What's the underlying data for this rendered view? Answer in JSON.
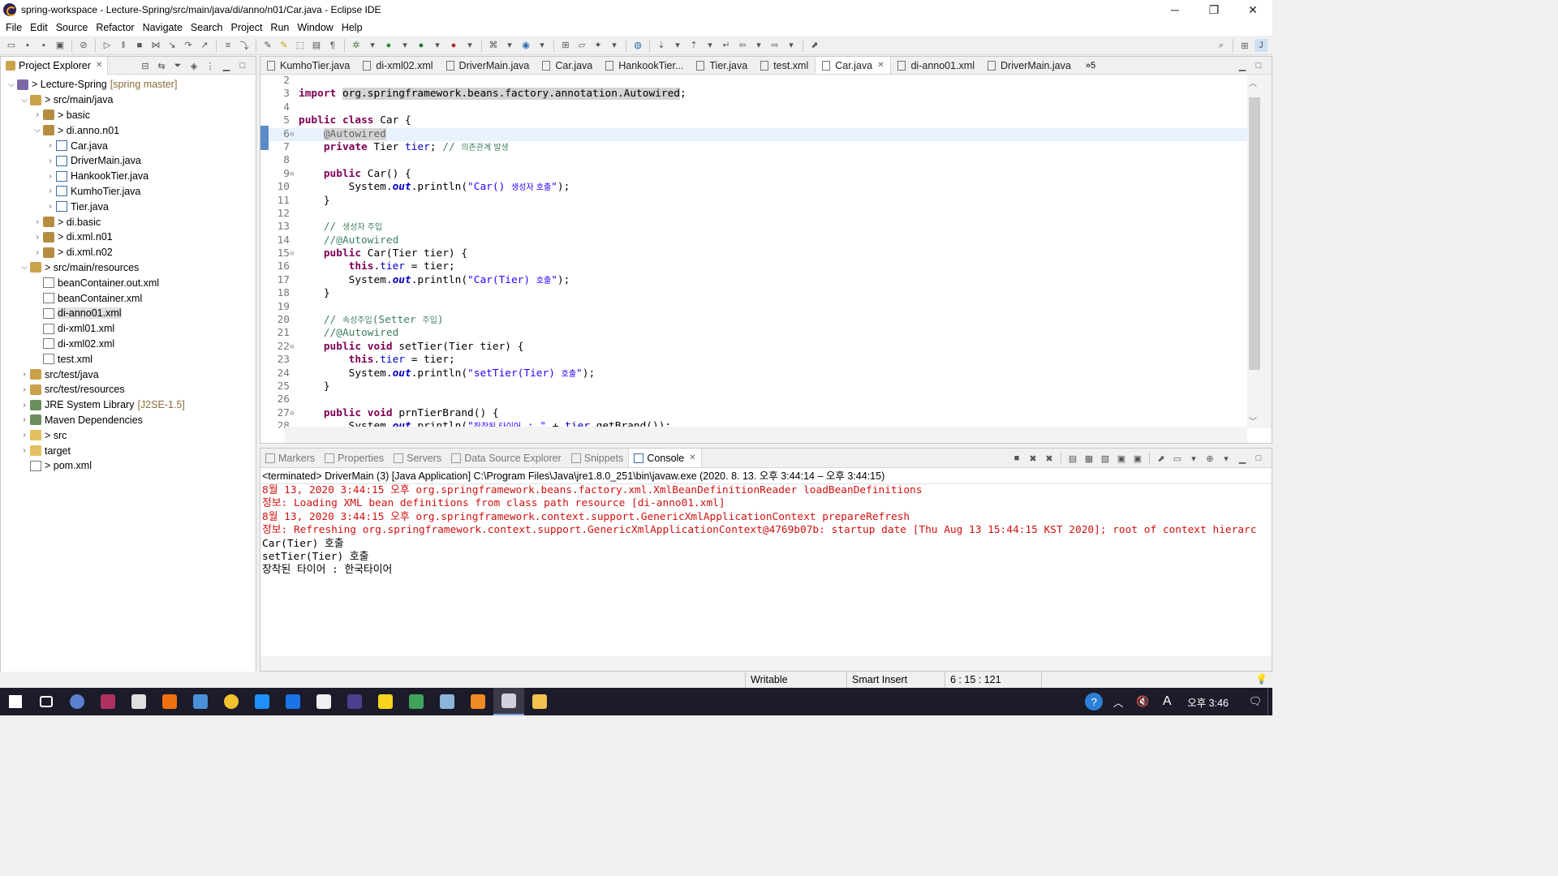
{
  "window": {
    "title": "spring-workspace - Lecture-Spring/src/main/java/di/anno/n01/Car.java - Eclipse IDE",
    "controls": [
      "minimize",
      "restore",
      "close"
    ]
  },
  "menu": [
    "File",
    "Edit",
    "Source",
    "Refactor",
    "Navigate",
    "Search",
    "Project",
    "Run",
    "Window",
    "Help"
  ],
  "explorer": {
    "title": "Project Explorer",
    "tree": [
      {
        "depth": 0,
        "expanded": true,
        "icon": "project-icon",
        "label": "> Lecture-Spring",
        "decor": "[spring master]"
      },
      {
        "depth": 1,
        "expanded": true,
        "icon": "source-folder-icon",
        "label": "> src/main/java",
        "decor": ""
      },
      {
        "depth": 2,
        "expanded": false,
        "icon": "package-icon",
        "label": "> basic",
        "decor": ""
      },
      {
        "depth": 2,
        "expanded": true,
        "icon": "package-icon",
        "label": "> di.anno.n01",
        "decor": ""
      },
      {
        "depth": 3,
        "expanded": false,
        "icon": "java-file-icon",
        "label": "Car.java",
        "decor": ""
      },
      {
        "depth": 3,
        "expanded": false,
        "icon": "java-file-icon",
        "label": "DriverMain.java",
        "decor": ""
      },
      {
        "depth": 3,
        "expanded": false,
        "icon": "java-file-icon",
        "label": "HankookTier.java",
        "decor": ""
      },
      {
        "depth": 3,
        "expanded": false,
        "icon": "java-file-icon",
        "label": "KumhoTier.java",
        "decor": ""
      },
      {
        "depth": 3,
        "expanded": false,
        "icon": "java-file-icon",
        "label": "Tier.java",
        "decor": ""
      },
      {
        "depth": 2,
        "expanded": false,
        "icon": "package-icon",
        "label": "> di.basic",
        "decor": ""
      },
      {
        "depth": 2,
        "expanded": false,
        "icon": "package-icon",
        "label": "> di.xml.n01",
        "decor": ""
      },
      {
        "depth": 2,
        "expanded": false,
        "icon": "package-icon",
        "label": "> di.xml.n02",
        "decor": ""
      },
      {
        "depth": 1,
        "expanded": true,
        "icon": "source-folder-icon",
        "label": "> src/main/resources",
        "decor": ""
      },
      {
        "depth": 2,
        "leaf": true,
        "icon": "xml-file-icon",
        "label": "beanContainer.out.xml",
        "decor": ""
      },
      {
        "depth": 2,
        "leaf": true,
        "icon": "xml-file-icon",
        "label": "beanContainer.xml",
        "decor": ""
      },
      {
        "depth": 2,
        "leaf": true,
        "icon": "xml-file-icon",
        "label": "di-anno01.xml",
        "decor": "",
        "selected": true
      },
      {
        "depth": 2,
        "leaf": true,
        "icon": "xml-file-icon",
        "label": "di-xml01.xml",
        "decor": ""
      },
      {
        "depth": 2,
        "leaf": true,
        "icon": "xml-file-icon",
        "label": "di-xml02.xml",
        "decor": ""
      },
      {
        "depth": 2,
        "leaf": true,
        "icon": "xml-file-icon",
        "label": "test.xml",
        "decor": ""
      },
      {
        "depth": 1,
        "expanded": false,
        "icon": "source-folder-icon",
        "label": "src/test/java",
        "decor": ""
      },
      {
        "depth": 1,
        "expanded": false,
        "icon": "source-folder-icon",
        "label": "src/test/resources",
        "decor": ""
      },
      {
        "depth": 1,
        "expanded": false,
        "icon": "library-icon",
        "label": "JRE System Library",
        "decor": "[J2SE-1.5]"
      },
      {
        "depth": 1,
        "expanded": false,
        "icon": "library-icon",
        "label": "Maven Dependencies",
        "decor": ""
      },
      {
        "depth": 1,
        "expanded": false,
        "icon": "folder-icon",
        "label": "> src",
        "decor": ""
      },
      {
        "depth": 1,
        "expanded": false,
        "icon": "folder-icon",
        "label": "target",
        "decor": ""
      },
      {
        "depth": 1,
        "leaf": true,
        "icon": "xml-file-icon",
        "label": "> pom.xml",
        "decor": ""
      }
    ]
  },
  "editor": {
    "tabs": [
      {
        "label": "KumhoTier.java",
        "active": false
      },
      {
        "label": "di-xml02.xml",
        "active": false
      },
      {
        "label": "DriverMain.java",
        "active": false
      },
      {
        "label": "Car.java",
        "active": false
      },
      {
        "label": "HankookTier...",
        "active": false
      },
      {
        "label": "Tier.java",
        "active": false
      },
      {
        "label": "test.xml",
        "active": false
      },
      {
        "label": "Car.java",
        "active": true
      },
      {
        "label": "di-anno01.xml",
        "active": false
      },
      {
        "label": "DriverMain.java",
        "active": false
      }
    ],
    "more_tabs": "»5",
    "lines": [
      {
        "n": "2",
        "fold": "",
        "html": ""
      },
      {
        "n": "3",
        "fold": "",
        "html": "<span class=\"kw\">import</span> <span class=\"hl\">org.springframework.beans.factory.annotation.Autowired</span>;"
      },
      {
        "n": "4",
        "fold": "",
        "html": ""
      },
      {
        "n": "5",
        "fold": "",
        "html": "<span class=\"kw\">public</span> <span class=\"kw\">class</span> Car {"
      },
      {
        "n": "6",
        "fold": "⊖",
        "html": "    <span class=\"ann hl\">@Autowired</span>",
        "current": true
      },
      {
        "n": "7",
        "fold": "",
        "html": "    <span class=\"kw\">private</span> Tier <span class=\"fld\">tier</span>; <span class=\"cm\">// <span class=\"ko\">의존관계 발생</span></span>"
      },
      {
        "n": "8",
        "fold": "",
        "html": ""
      },
      {
        "n": "9",
        "fold": "⊖",
        "html": "    <span class=\"kw\">public</span> Car() {"
      },
      {
        "n": "10",
        "fold": "",
        "html": "        System.<span class=\"stat\">out</span>.println(<span class=\"str\">\"Car() <span class=\"ko\">생성자 호출</span>\"</span>);"
      },
      {
        "n": "11",
        "fold": "",
        "html": "    }"
      },
      {
        "n": "12",
        "fold": "",
        "html": ""
      },
      {
        "n": "13",
        "fold": "",
        "html": "    <span class=\"cm\">// <span class=\"ko\">생성자 주입</span></span>"
      },
      {
        "n": "14",
        "fold": "",
        "html": "    <span class=\"cm\">//@Autowired</span>"
      },
      {
        "n": "15",
        "fold": "⊖",
        "html": "    <span class=\"kw\">public</span> Car(Tier tier) {"
      },
      {
        "n": "16",
        "fold": "",
        "html": "        <span class=\"kw\">this</span>.<span class=\"fld\">tier</span> = tier;"
      },
      {
        "n": "17",
        "fold": "",
        "html": "        System.<span class=\"stat\">out</span>.println(<span class=\"str\">\"Car(Tier) <span class=\"ko\">호출</span>\"</span>);"
      },
      {
        "n": "18",
        "fold": "",
        "html": "    }"
      },
      {
        "n": "19",
        "fold": "",
        "html": ""
      },
      {
        "n": "20",
        "fold": "",
        "html": "    <span class=\"cm\">// <span class=\"ko\">속성주입</span>(Setter <span class=\"ko\">주입</span>)</span>"
      },
      {
        "n": "21",
        "fold": "",
        "html": "    <span class=\"cm\">//@Autowired</span>"
      },
      {
        "n": "22",
        "fold": "⊖",
        "html": "    <span class=\"kw\">public</span> <span class=\"kw\">void</span> setTier(Tier tier) {"
      },
      {
        "n": "23",
        "fold": "",
        "html": "        <span class=\"kw\">this</span>.<span class=\"fld\">tier</span> = tier;"
      },
      {
        "n": "24",
        "fold": "",
        "html": "        System.<span class=\"stat\">out</span>.println(<span class=\"str\">\"setTier(Tier) <span class=\"ko\">호출</span>\"</span>);"
      },
      {
        "n": "25",
        "fold": "",
        "html": "    }"
      },
      {
        "n": "26",
        "fold": "",
        "html": ""
      },
      {
        "n": "27",
        "fold": "⊖",
        "html": "    <span class=\"kw\">public</span> <span class=\"kw\">void</span> prnTierBrand() {"
      },
      {
        "n": "28",
        "fold": "",
        "html": "        System.<span class=\"stat\">out</span>.println(<span class=\"str\">\"<span class=\"ko\">장착된 타이어</span> : \"</span> + <span class=\"fld\">tier</span>.getBrand());"
      }
    ]
  },
  "console": {
    "tabs": [
      {
        "label": "Markers",
        "active": false
      },
      {
        "label": "Properties",
        "active": false
      },
      {
        "label": "Servers",
        "active": false
      },
      {
        "label": "Data Source Explorer",
        "active": false
      },
      {
        "label": "Snippets",
        "active": false
      },
      {
        "label": "Console",
        "active": true
      }
    ],
    "status": "<terminated> DriverMain (3) [Java Application] C:\\Program Files\\Java\\jre1.8.0_251\\bin\\javaw.exe  (2020. 8. 13. 오후 3:44:14 – 오후 3:44:15)",
    "output": [
      {
        "text": "8월 13, 2020 3:44:15 오후 org.springframework.beans.factory.xml.XmlBeanDefinitionReader loadBeanDefinitions",
        "err": true
      },
      {
        "text": "정보: Loading XML bean definitions from class path resource [di-anno01.xml]",
        "err": true
      },
      {
        "text": "8월 13, 2020 3:44:15 오후 org.springframework.context.support.GenericXmlApplicationContext prepareRefresh",
        "err": true
      },
      {
        "text": "정보: Refreshing org.springframework.context.support.GenericXmlApplicationContext@4769b07b: startup date [Thu Aug 13 15:44:15 KST 2020]; root of context hierarchy",
        "err": true
      },
      {
        "text": "Car(Tier) 호출",
        "err": false
      },
      {
        "text": "setTier(Tier) 호출",
        "err": false
      },
      {
        "text": "장착된 타이어 : 한국타이어",
        "err": false
      }
    ]
  },
  "statusbar": {
    "writable": "Writable",
    "insert_mode": "Smart Insert",
    "position": "6 : 15 : 121"
  },
  "taskbar": {
    "clock": "오후 3:46",
    "ime": "A",
    "apps": [
      {
        "name": "start-icon",
        "color": "#ffffff"
      },
      {
        "name": "task-view-icon",
        "color": "#ffffff"
      },
      {
        "name": "r-app-icon",
        "color": "#5b7fcf"
      },
      {
        "name": "winrar-icon",
        "color": "#b03060"
      },
      {
        "name": "notes-icon",
        "color": "#e0e0e0"
      },
      {
        "name": "search-app-icon",
        "color": "#f07010"
      },
      {
        "name": "network-icon",
        "color": "#4a90d9"
      },
      {
        "name": "chrome-icon",
        "color": "#f2c12e"
      },
      {
        "name": "ie-icon",
        "color": "#1e90ff"
      },
      {
        "name": "edge-icon",
        "color": "#1a73e8"
      },
      {
        "name": "chat-icon",
        "color": "#f0f0f0"
      },
      {
        "name": "eclipse-dark-icon",
        "color": "#4b3f8f"
      },
      {
        "name": "sticky-notes-icon",
        "color": "#f7d420"
      },
      {
        "name": "media-icon",
        "color": "#3fa35a"
      },
      {
        "name": "pen-icon",
        "color": "#8ab4d8"
      },
      {
        "name": "sublime-icon",
        "color": "#f08a24"
      },
      {
        "name": "eclipse-icon",
        "color": "#cfcfe0"
      },
      {
        "name": "file-explorer-icon",
        "color": "#f2c14e"
      }
    ]
  }
}
